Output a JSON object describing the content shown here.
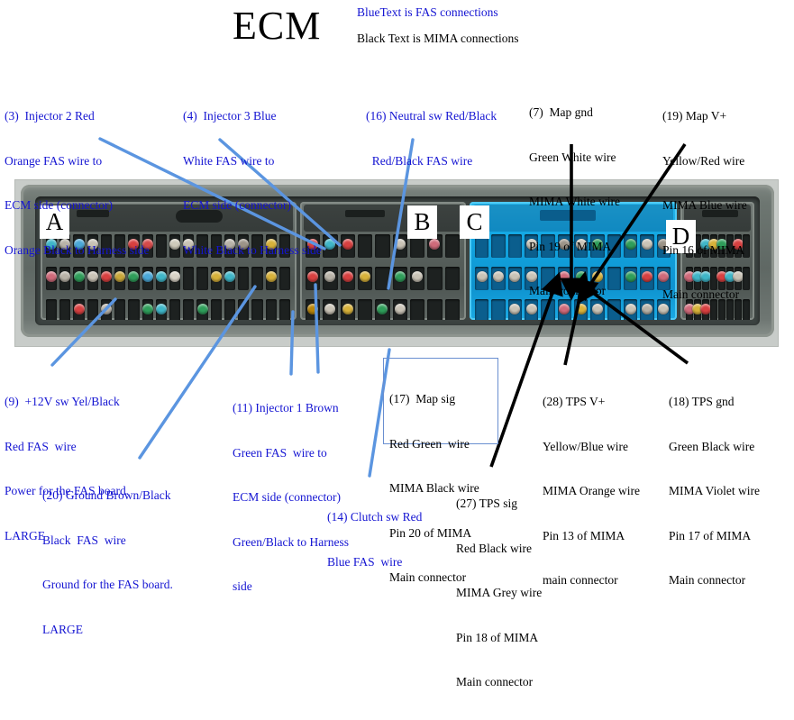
{
  "title": "ECM",
  "legend": {
    "blue": "BlueText is FAS connections",
    "black": "Black Text is MIMA connections"
  },
  "colors": {
    "fas_text": "#1414d2",
    "mima_text": "#000000",
    "leader_blue": "#5b95e0",
    "leader_black": "#000000",
    "connector_c": "#12a6e2",
    "housing_grey": "#5f6864"
  },
  "connector_letters": [
    {
      "label": "A"
    },
    {
      "label": "B"
    },
    {
      "label": "C"
    },
    {
      "label": "D"
    }
  ],
  "notes": [
    {
      "id": "note-3",
      "style": "fas",
      "lines": [
        "(3)  Injector 2 Red",
        "Orange FAS wire to",
        "ECM side (connector)",
        "Orange Black to Harness side"
      ]
    },
    {
      "id": "note-4",
      "style": "fas",
      "lines": [
        "(4)  Injector 3 Blue",
        "White FAS wire to",
        "ECM side (connector)",
        "White Black to Harness side"
      ]
    },
    {
      "id": "note-16",
      "style": "fas",
      "lines": [
        "(16) Neutral sw Red/Black",
        "  Red/Black FAS wire"
      ]
    },
    {
      "id": "note-7",
      "style": "mima",
      "lines": [
        "(7)  Map gnd",
        "Green White wire",
        "MIMA White wire",
        "Pin 19 of MIMA",
        "Main connector"
      ]
    },
    {
      "id": "note-19",
      "style": "mima",
      "lines": [
        "(19) Map V+",
        "Yellow/Red wire",
        "MIMA Blue wire",
        "Pin 16 of MIMA",
        "Main connector"
      ]
    },
    {
      "id": "note-9",
      "style": "fas",
      "lines": [
        "(9)  +12V sw Yel/Black",
        "Red FAS  wire",
        "Power for the FAS board.",
        "LARGE"
      ]
    },
    {
      "id": "note-20",
      "style": "fas",
      "lines": [
        "(20) Ground Brown/Black",
        "Black  FAS  wire",
        "Ground for the FAS board.",
        "LARGE"
      ]
    },
    {
      "id": "note-11",
      "style": "fas",
      "lines": [
        "(11) Injector 1 Brown",
        "Green FAS  wire to",
        "ECM side (connector)",
        "Green/Black to Harness",
        "side"
      ]
    },
    {
      "id": "note-17",
      "style": "mima",
      "boxed": true,
      "lines": [
        "(17)  Map sig",
        "Red Green  wire",
        "MIMA Black wire",
        "Pin 20 of MIMA",
        "Main connector"
      ]
    },
    {
      "id": "note-14",
      "style": "fas",
      "lines": [
        "(14) Clutch sw Red",
        "Blue FAS  wire"
      ]
    },
    {
      "id": "note-27",
      "style": "mima",
      "lines": [
        "(27) TPS sig",
        "Red Black wire",
        "MIMA Grey wire",
        "Pin 18 of MIMA",
        "Main connector"
      ]
    },
    {
      "id": "note-28",
      "style": "mima",
      "lines": [
        "(28) TPS V+",
        "Yellow/Blue wire",
        "MIMA Orange wire",
        "Pin 13 of MIMA",
        "main connector"
      ]
    },
    {
      "id": "note-18",
      "style": "mima",
      "lines": [
        "(18) TPS gnd",
        "Green Black wire",
        "MIMA Violet wire",
        "Pin 17 of MIMA",
        "Main connector"
      ]
    }
  ],
  "pin_colors": {
    "connector_a": [
      [
        "#3fb6c8",
        "#b9b3a8",
        "#4aa8d8",
        "#c9c3b6",
        "",
        "",
        "#d84040",
        "#d64a4a",
        "",
        "#cfcabb",
        "#c9c3b6",
        "",
        "",
        "#b9b3a8",
        "#9c9488",
        "",
        "#d8b23a",
        ""
      ],
      [
        "#d06a7a",
        "#b9b3a8",
        "#2f9e5a",
        "#c9c3b6",
        "#d84040",
        "#caa83a",
        "#2f9e5a",
        "#4aa8d8",
        "#3fb6c8",
        "#d8d2c6",
        "",
        "",
        "#d8b23a",
        "#3fb6c8",
        "",
        "",
        "#d8b23a",
        ""
      ],
      [
        "",
        "",
        "#d84040",
        "",
        "#b9b3a8",
        "",
        "",
        "#2f9e5a",
        "#3fb6c8",
        "",
        "",
        "#2f9e5a",
        "",
        "",
        "",
        "",
        "",
        ""
      ]
    ],
    "connector_b": [
      [
        "#d84040",
        "#3fb6c8",
        "#d84040",
        "",
        "",
        "#c9c3b6",
        "",
        "#d06a7a",
        ""
      ],
      [
        "#d84040",
        "#b9b3a8",
        "#d84040",
        "#d8b23a",
        "",
        "#2f9e5a",
        "#c9c3b6",
        "",
        ""
      ],
      [
        "#b9860b",
        "#c9c3b6",
        "#d8b23a",
        "",
        "#2f9e5a",
        "#c9c3b6",
        "",
        "",
        ""
      ]
    ],
    "connector_c": [
      [
        "",
        "",
        "",
        "#c9c3b6",
        "",
        "#9c9488",
        "#c9c3b6",
        "#2f9e5a",
        "",
        "#2f9e5a",
        "#c9c3b6",
        "#9c9488"
      ],
      [
        "#c9c3b6",
        "#c9c3b6",
        "#c9c3b6",
        "#c9c3b6",
        "",
        "#d06a7a",
        "#2f9e5a",
        "#d8b23a",
        "",
        "#2f9e5a",
        "#d84040",
        "#d06a7a"
      ],
      [
        "",
        "",
        "#c9c3b6",
        "#c9c3b6",
        "",
        "#d06a7a",
        "#d8b23a",
        "#c9c3b6",
        "",
        "#c9c3b6",
        "#b9b3a8",
        "#c9c3b6"
      ]
    ],
    "connector_d": [
      [
        "#3fb6c8",
        "",
        "#3fb6c8",
        "#d8b23a",
        "#2f9e5a",
        "",
        "#d84040",
        ""
      ],
      [
        "#d06a7a",
        "#3fb6c8",
        "#3fb6c8",
        "",
        "#d84040",
        "#3fb6c8",
        "#c9c3b6",
        ""
      ],
      [
        "#d06a7a",
        "#d8b23a",
        "#d84040",
        "",
        "",
        "",
        "",
        ""
      ]
    ]
  }
}
